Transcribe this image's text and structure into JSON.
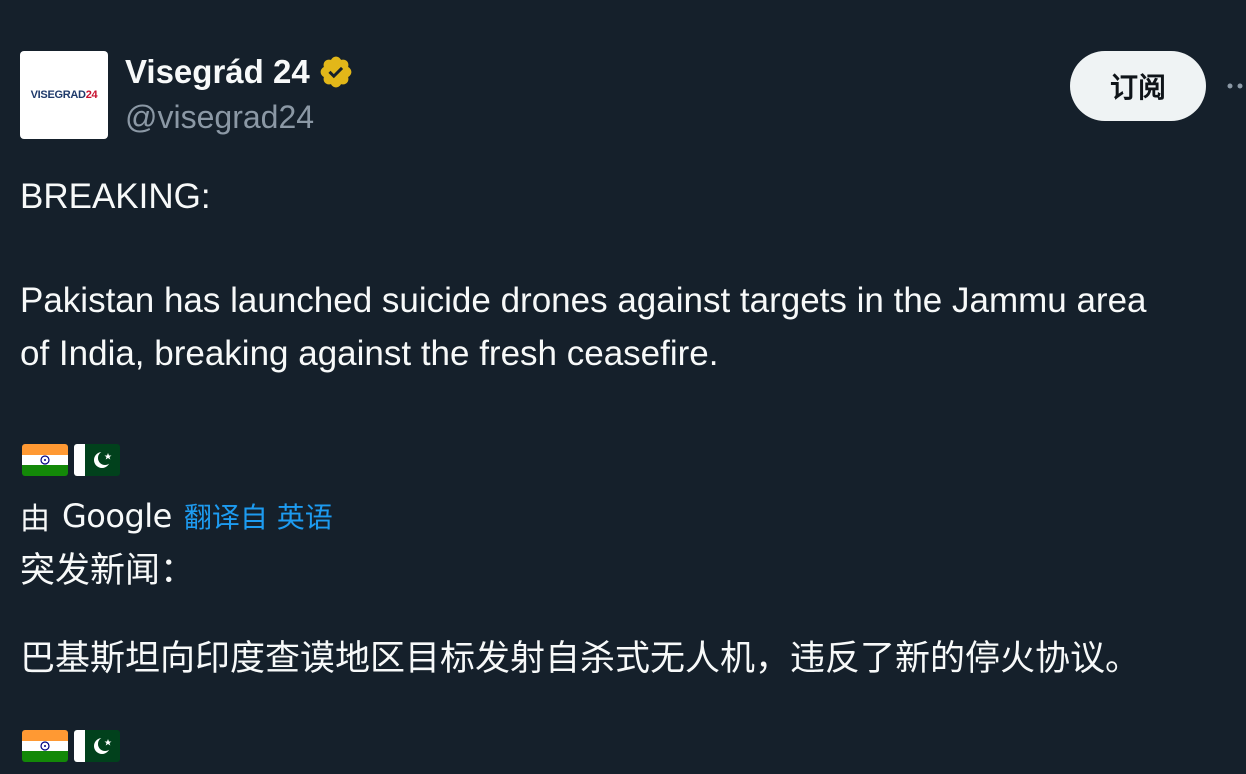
{
  "tweet": {
    "author": {
      "display_name": "Visegrád 24",
      "handle": "@visegrad24",
      "avatar_text_main": "VISEGRAD",
      "avatar_text_accent": "24",
      "verified": true
    },
    "subscribe_label": "订阅",
    "text": {
      "heading": "BREAKING:",
      "line1": "Pakistan has launched suicide drones against targets in the Jammu area",
      "line2": "of India, breaking against the fresh ceasefire."
    },
    "flags": [
      "india-flag",
      "pakistan-flag"
    ],
    "translation": {
      "by_label": "由",
      "provider": "Google",
      "translated_from_label": "翻译自 英语",
      "heading": "突发新闻：",
      "body": "巴基斯坦向印度查谟地区目标发射自杀式无人机，违反了新的停火协议。"
    }
  },
  "colors": {
    "background": "#15202b",
    "text": "#f7f9f9",
    "secondary_text": "#8b98a5",
    "link": "#1d9bf0",
    "verified_badge": "#e2b719",
    "button_bg": "#eff3f4"
  }
}
